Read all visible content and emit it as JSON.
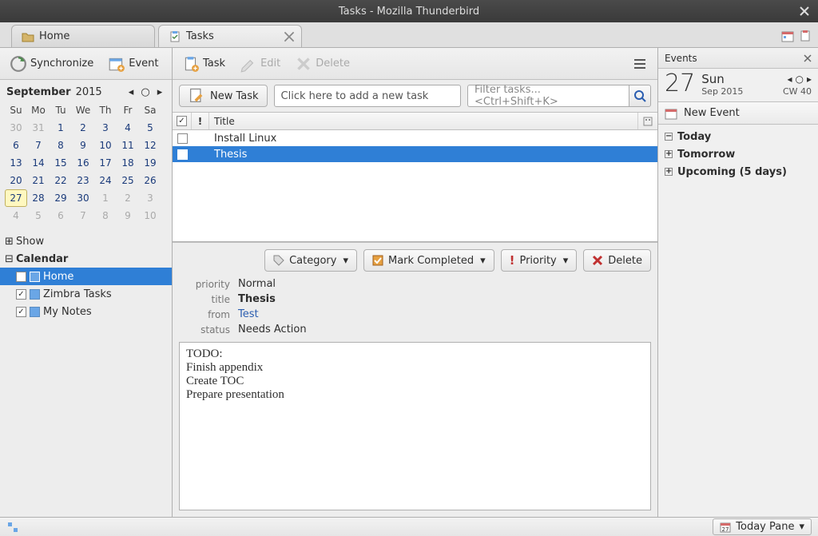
{
  "window": {
    "title": "Tasks - Mozilla Thunderbird"
  },
  "tabs": [
    {
      "label": "Home",
      "icon": "folder-icon"
    },
    {
      "label": "Tasks",
      "icon": "clipboard-icon"
    }
  ],
  "toolbar": {
    "synchronize": "Synchronize",
    "event": "Event",
    "task": "Task",
    "edit": "Edit",
    "delete": "Delete"
  },
  "calendar": {
    "month": "September",
    "year": "2015",
    "days_header": [
      "Su",
      "Mo",
      "Tu",
      "We",
      "Th",
      "Fr",
      "Sa"
    ],
    "cells": [
      {
        "d": "30",
        "other": true
      },
      {
        "d": "31",
        "other": true
      },
      {
        "d": "1"
      },
      {
        "d": "2"
      },
      {
        "d": "3"
      },
      {
        "d": "4"
      },
      {
        "d": "5"
      },
      {
        "d": "6"
      },
      {
        "d": "7"
      },
      {
        "d": "8"
      },
      {
        "d": "9"
      },
      {
        "d": "10"
      },
      {
        "d": "11"
      },
      {
        "d": "12"
      },
      {
        "d": "13"
      },
      {
        "d": "14"
      },
      {
        "d": "15"
      },
      {
        "d": "16"
      },
      {
        "d": "17"
      },
      {
        "d": "18"
      },
      {
        "d": "19"
      },
      {
        "d": "20"
      },
      {
        "d": "21"
      },
      {
        "d": "22"
      },
      {
        "d": "23"
      },
      {
        "d": "24"
      },
      {
        "d": "25"
      },
      {
        "d": "26"
      },
      {
        "d": "27",
        "today": true
      },
      {
        "d": "28"
      },
      {
        "d": "29"
      },
      {
        "d": "30"
      },
      {
        "d": "1",
        "other": true
      },
      {
        "d": "2",
        "other": true
      },
      {
        "d": "3",
        "other": true
      },
      {
        "d": "4",
        "other": true
      },
      {
        "d": "5",
        "other": true
      },
      {
        "d": "6",
        "other": true
      },
      {
        "d": "7",
        "other": true
      },
      {
        "d": "8",
        "other": true
      },
      {
        "d": "9",
        "other": true
      },
      {
        "d": "10",
        "other": true
      }
    ]
  },
  "tree": {
    "show": "Show",
    "calendar": "Calendar",
    "items": [
      {
        "label": "Home",
        "checked": false,
        "selected": true
      },
      {
        "label": "Zimbra Tasks",
        "checked": true,
        "selected": false
      },
      {
        "label": "My Notes",
        "checked": true,
        "selected": false
      }
    ]
  },
  "center": {
    "new_task": "New Task",
    "new_task_placeholder": "Click here to add a new task",
    "filter_placeholder": "Filter tasks... <Ctrl+Shift+K>",
    "columns": {
      "title": "Title"
    },
    "tasks": [
      {
        "title": "Install Linux",
        "selected": false
      },
      {
        "title": "Thesis",
        "selected": true
      }
    ]
  },
  "detail": {
    "buttons": {
      "category": "Category",
      "mark_completed": "Mark Completed",
      "priority": "Priority",
      "delete": "Delete"
    },
    "labels": {
      "priority": "priority",
      "title": "title",
      "from": "from",
      "status": "status"
    },
    "values": {
      "priority": "Normal",
      "title": "Thesis",
      "from": "Test",
      "status": "Needs Action"
    },
    "description": "TODO:\nFinish appendix\nCreate TOC\nPrepare presentation"
  },
  "events": {
    "header": "Events",
    "big_day": "27",
    "day_name": "Sun",
    "month_year": "Sep 2015",
    "week": "CW 40",
    "new_event": "New Event",
    "agenda": [
      {
        "label": "Today",
        "expanded": true,
        "bold": true
      },
      {
        "label": "Tomorrow",
        "expanded": false,
        "bold": true
      },
      {
        "label": "Upcoming (5 days)",
        "expanded": false,
        "bold": true
      }
    ]
  },
  "statusbar": {
    "today_pane": "Today Pane"
  }
}
